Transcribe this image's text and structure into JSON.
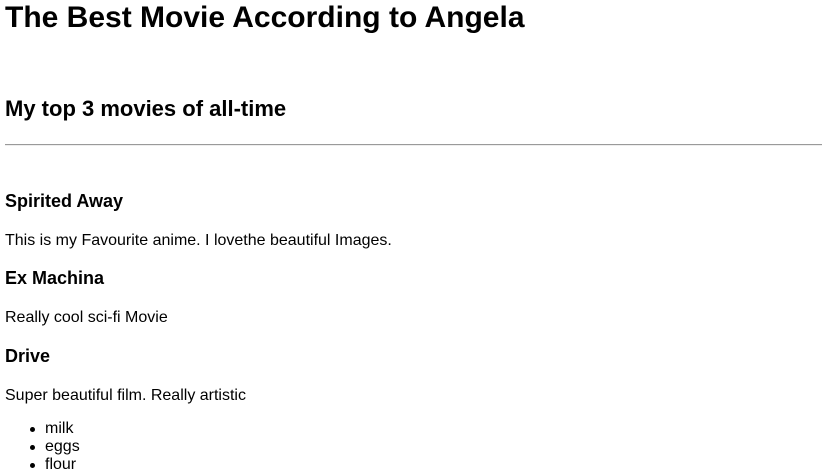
{
  "page": {
    "title": "The Best Movie According to Angela",
    "subtitle": "My top 3 movies of all-time"
  },
  "movies": [
    {
      "title": "Spirited Away",
      "description": "This is my Favourite anime. I lovethe beautiful Images."
    },
    {
      "title": "Ex Machina",
      "description": "Really cool sci-fi Movie"
    },
    {
      "title": "Drive",
      "description": "Super beautiful film. Really artistic"
    }
  ],
  "list": {
    "items": [
      "milk",
      "eggs",
      "flour"
    ]
  }
}
